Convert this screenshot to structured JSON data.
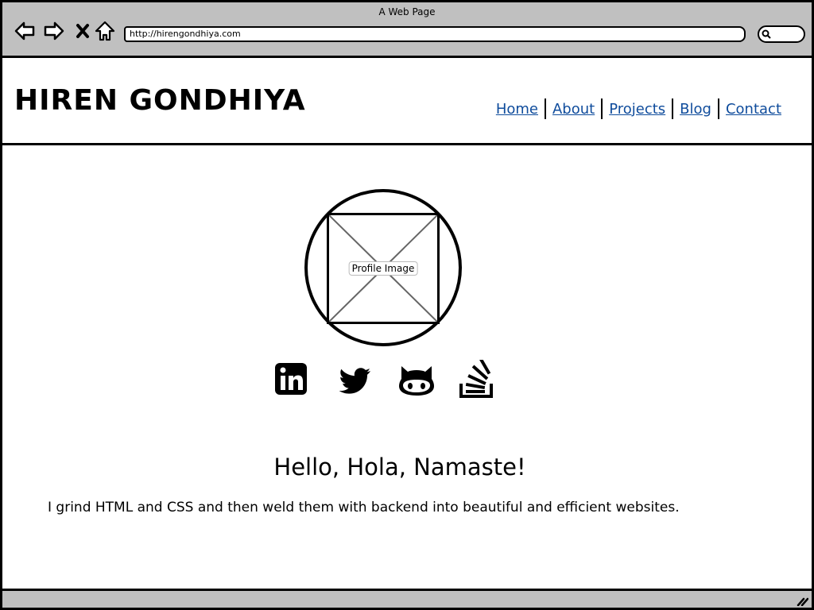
{
  "window": {
    "title": "A Web Page",
    "url": "http://hirengondhiya.com"
  },
  "toolbar": {
    "icons": [
      "back-arrow-icon",
      "forward-arrow-icon",
      "close-x-icon",
      "home-icon",
      "search-icon"
    ]
  },
  "header": {
    "logo": "HIREN GONDHIYA",
    "nav": [
      {
        "label": "Home"
      },
      {
        "label": "About"
      },
      {
        "label": "Projects"
      },
      {
        "label": "Blog"
      },
      {
        "label": "Contact"
      }
    ],
    "link_color": "#0f4c9c"
  },
  "profile": {
    "image_label": "Profile Image"
  },
  "social": [
    {
      "name": "linkedin",
      "icon": "linkedin-icon"
    },
    {
      "name": "twitter",
      "icon": "twitter-icon"
    },
    {
      "name": "github",
      "icon": "github-icon"
    },
    {
      "name": "stackoverflow",
      "icon": "stackoverflow-icon"
    }
  ],
  "content": {
    "greeting": "Hello, Hola, Namaste!",
    "bio": "I grind HTML and CSS and then weld them with backend into beautiful and efficient websites."
  }
}
